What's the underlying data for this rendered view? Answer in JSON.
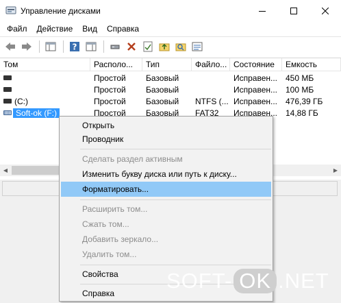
{
  "window": {
    "title": "Управление дисками",
    "minimize_glyph": "—",
    "maximize_glyph": "☐",
    "close_glyph": "✕"
  },
  "menubar": {
    "items": [
      "Файл",
      "Действие",
      "Вид",
      "Справка"
    ]
  },
  "toolbar": {
    "icons": [
      "back-arrow-icon",
      "forward-arrow-icon",
      "console-tree-icon",
      "help-icon",
      "action-pane-icon",
      "connect-drive-icon",
      "delete-icon",
      "checklist-icon",
      "folder-up-icon",
      "search-folder-icon",
      "properties-icon"
    ]
  },
  "volumes": {
    "columns": [
      "Том",
      "Располо...",
      "Тип",
      "Файло...",
      "Состояние",
      "Емкость"
    ],
    "rows": [
      {
        "name": "",
        "layout": "Простой",
        "type": "Базовый",
        "fs": "",
        "status": "Исправен...",
        "capacity": "450 МБ"
      },
      {
        "name": "",
        "layout": "Простой",
        "type": "Базовый",
        "fs": "",
        "status": "Исправен...",
        "capacity": "100 МБ"
      },
      {
        "name": "(C:)",
        "layout": "Простой",
        "type": "Базовый",
        "fs": "NTFS (...",
        "status": "Исправен...",
        "capacity": "476,39 ГБ"
      },
      {
        "name": "Soft-ok (F:)",
        "layout": "Простой",
        "type": "Базовый",
        "fs": "FAT32",
        "status": "Исправен...",
        "capacity": "14,88 ГБ"
      }
    ]
  },
  "context_menu": {
    "open": "Открыть",
    "explorer": "Проводник",
    "mark_active": "Сделать раздел активным",
    "change_letter": "Изменить букву диска или путь к диску...",
    "format": "Форматировать...",
    "extend": "Расширить том...",
    "shrink": "Сжать том...",
    "add_mirror": "Добавить зеркало...",
    "delete": "Удалить том...",
    "properties": "Свойства",
    "help": "Справка"
  },
  "watermark": {
    "left": "SOFT-",
    "ok": "OK",
    "right": ".NET"
  },
  "colors": {
    "selection": "#3399ff",
    "menu_hover": "#91c9f7",
    "disabled_text": "#8c8c8c"
  }
}
